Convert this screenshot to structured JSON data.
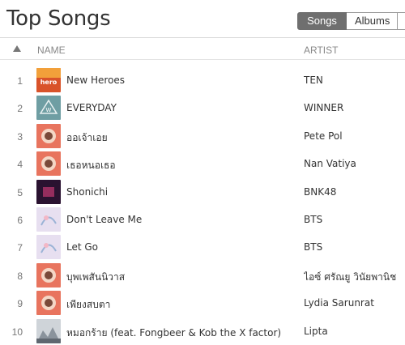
{
  "header": {
    "title": "Top Songs",
    "tabs": [
      {
        "label": "Songs",
        "active": true
      },
      {
        "label": "Albums",
        "active": false
      }
    ]
  },
  "columns": {
    "name": "NAME",
    "artist": "ARTIST",
    "sort_icon": "sort-ascending-icon"
  },
  "songs": [
    {
      "rank": "1",
      "title": "New Heroes",
      "artist": "TEN",
      "art": "orange-cover"
    },
    {
      "rank": "2",
      "title": "EVERYDAY",
      "artist": "WINNER",
      "art": "teal-cover"
    },
    {
      "rank": "3",
      "title": "ออเจ้าเอย",
      "artist": "Pete Pol",
      "art": "salmon-cover"
    },
    {
      "rank": "4",
      "title": "เธอหนอเธอ",
      "artist": "Nan Vatiya",
      "art": "salmon-cover"
    },
    {
      "rank": "5",
      "title": "Shonichi",
      "artist": "BNK48",
      "art": "dark-cover"
    },
    {
      "rank": "6",
      "title": "Don't Leave Me",
      "artist": "BTS",
      "art": "pastel-cover"
    },
    {
      "rank": "7",
      "title": "Let Go",
      "artist": "BTS",
      "art": "pastel-cover"
    },
    {
      "rank": "8",
      "title": "บุพเพสันนิวาส",
      "artist": "ไอซ์ ศรัณยู วินัยพานิช",
      "art": "salmon-cover"
    },
    {
      "rank": "9",
      "title": "เพียงสบตา",
      "artist": "Lydia Sarunrat",
      "art": "salmon-cover"
    },
    {
      "rank": "10",
      "title": "หมอกร้าย (feat. Fongbeer & Kob the X factor)",
      "artist": "Lipta",
      "art": "grey-cover"
    }
  ],
  "colors": {
    "orange-cover": "#d9532a",
    "teal-cover": "#6f9ea3",
    "salmon-cover": "#e8745e",
    "dark-cover": "#2a1230",
    "pastel-cover": "#e7dff0",
    "grey-cover": "#b9bec4"
  }
}
